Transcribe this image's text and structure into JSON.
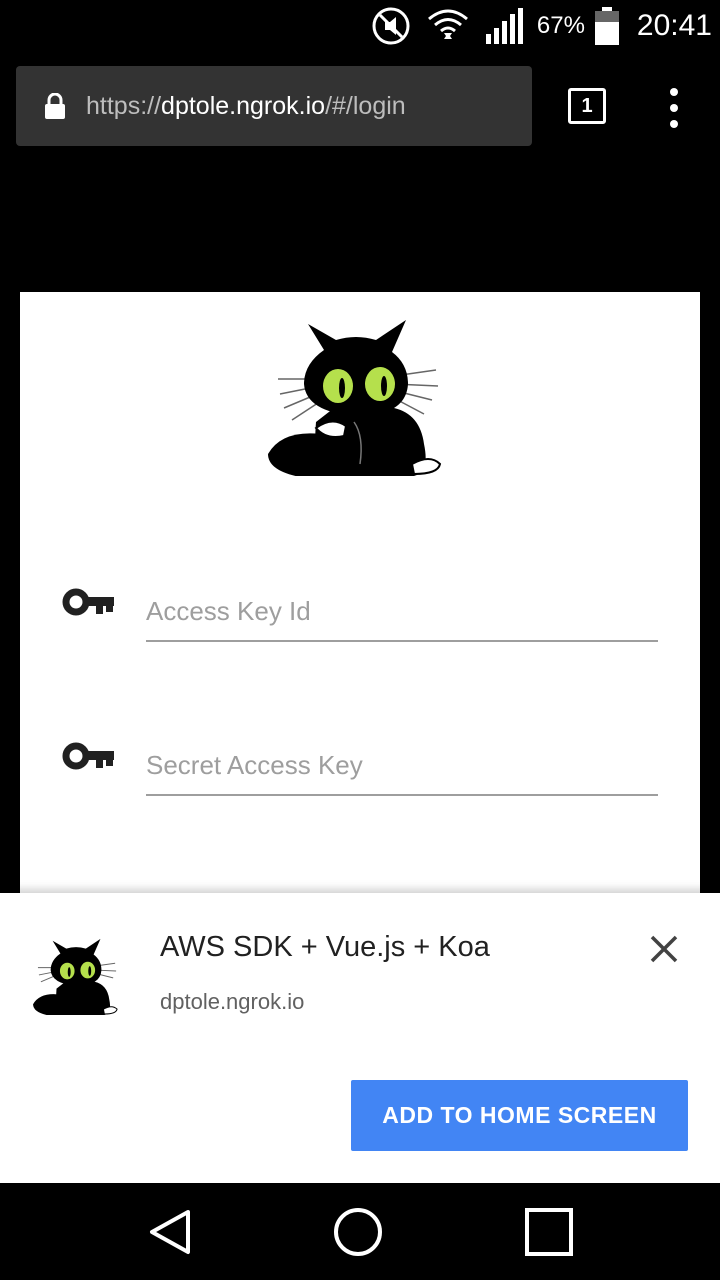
{
  "status_bar": {
    "battery": "67%",
    "time": "20:41",
    "icons": [
      "mute-icon",
      "wifi-icon",
      "signal-icon",
      "battery-icon"
    ]
  },
  "browser": {
    "url_scheme": "https://",
    "url_host": "dptole.ngrok.io",
    "url_path": "/#/login",
    "tab_count": "1"
  },
  "login": {
    "access_key_placeholder": "Access Key Id",
    "secret_key_placeholder": "Secret Access Key"
  },
  "install_banner": {
    "title": "AWS SDK + Vue.js + Koa",
    "url": "dptole.ngrok.io",
    "button_label": "ADD TO HOME SCREEN",
    "button_color": "#4285f4"
  },
  "nav_bar": {
    "icons": [
      "back-icon",
      "home-icon",
      "recents-icon"
    ]
  }
}
